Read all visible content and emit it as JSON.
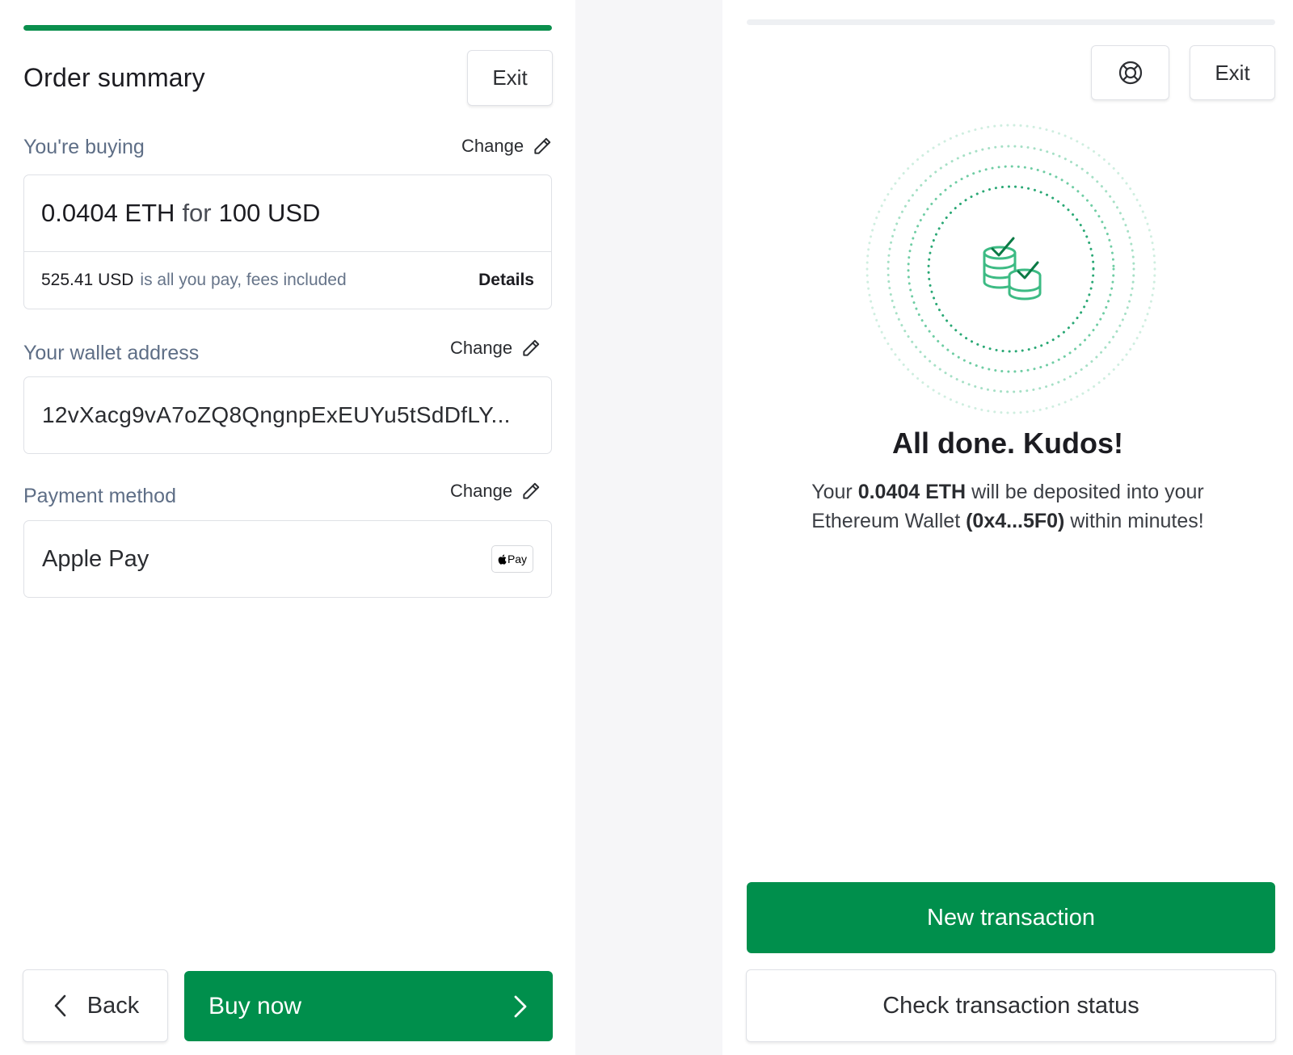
{
  "left": {
    "progress": 1.0,
    "title": "Order summary",
    "exit_label": "Exit",
    "buying": {
      "label": "You're buying",
      "change_label": "Change",
      "amount_crypto": "0.0404 ETH",
      "connector": "for",
      "amount_fiat": "100 USD",
      "total": "525.41 USD",
      "total_note": "is all you pay, fees included",
      "details_label": "Details"
    },
    "wallet": {
      "label": "Your wallet address",
      "change_label": "Change",
      "address": "12vXacg9vA7oZQ8QngnpExEUYu5tSdDfLY..."
    },
    "payment": {
      "label": "Payment method",
      "change_label": "Change",
      "method": "Apple Pay",
      "badge_text": "Pay",
      "badge_icon": "apple-logo-icon"
    },
    "back_label": "Back",
    "buy_label": "Buy now"
  },
  "right": {
    "exit_label": "Exit",
    "help_icon": "lifebuoy-icon",
    "success_icon": "coins-check-icon",
    "title": "All done. Kudos!",
    "msg_part1": "Your",
    "msg_amount": "0.0404 ETH",
    "msg_part2": "will be deposited into your",
    "msg_part3": "Ethereum Wallet",
    "msg_wallet": "(0x4...5F0)",
    "msg_part4": "within minutes!",
    "new_tx_label": "New transaction",
    "check_label": "Check transaction status"
  },
  "colors": {
    "brand_green": "#008f4c",
    "label_gray": "#5e6e86",
    "border": "#dfe1e6"
  }
}
